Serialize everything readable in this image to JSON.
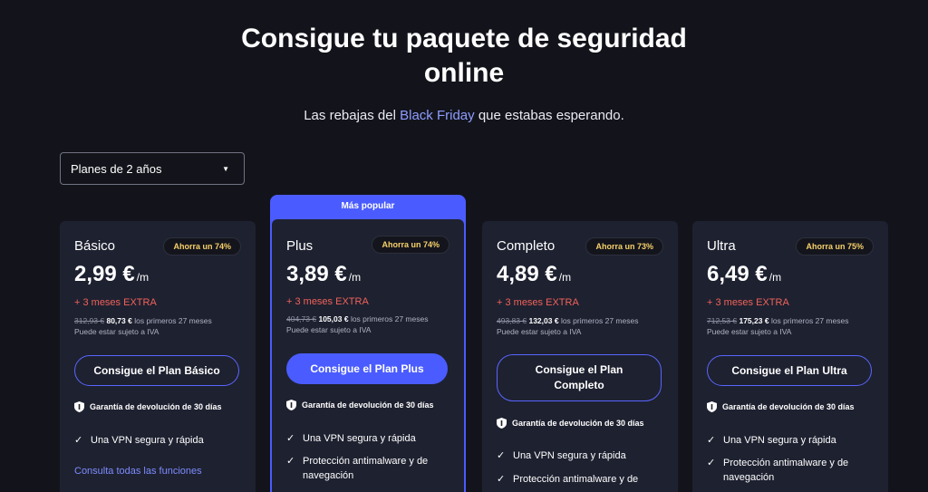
{
  "hero": {
    "title_line1": "Consigue tu paquete de seguridad",
    "title_line2": "online",
    "subtitle_before": "Las rebajas del ",
    "subtitle_highlight": "Black Friday",
    "subtitle_after": " que estabas esperando."
  },
  "term_select": {
    "value": "Planes de 2 años"
  },
  "popular_label": "Más popular",
  "colors": {
    "accent": "#4a5cff",
    "background": "#13141b",
    "card": "#1e2130",
    "extra_red": "#f0625a",
    "badge_yellow": "#f7d16a",
    "link": "#7d8cff"
  },
  "plans": [
    {
      "name": "Básico",
      "badge": "Ahorra un 74%",
      "price": "2,99 €",
      "per": "/m",
      "extra": "+ 3 meses EXTRA",
      "old_total": "312,93 €",
      "new_total": "80,73 €",
      "period_note": "los primeros 27 meses",
      "tax_note": "Puede estar sujeto a IVA",
      "cta": "Consigue el Plan Básico",
      "guarantee": "Garantía de devolución de 30 días",
      "features": [
        "Una VPN segura y rápida"
      ],
      "see_all": "Consulta todas las funciones"
    },
    {
      "name": "Plus",
      "badge": "Ahorra un 74%",
      "price": "3,89 €",
      "per": "/m",
      "extra": "+ 3 meses EXTRA",
      "old_total": "404,73 €",
      "new_total": "105,03 €",
      "period_note": "los primeros 27 meses",
      "tax_note": "Puede estar sujeto a IVA",
      "cta": "Consigue el Plan Plus",
      "guarantee": "Garantía de devolución de 30 días",
      "features": [
        "Una VPN segura y rápida",
        "Protección antimalware y de navegación"
      ]
    },
    {
      "name": "Completo",
      "badge": "Ahorra un 73%",
      "price": "4,89 €",
      "per": "/m",
      "extra": "+ 3 meses EXTRA",
      "old_total": "493,83 €",
      "new_total": "132,03 €",
      "period_note": "los primeros 27 meses",
      "tax_note": "Puede estar sujeto a IVA",
      "cta": "Consigue el Plan Completo",
      "guarantee": "Garantía de devolución de 30 días",
      "features": [
        "Una VPN segura y rápida",
        "Protección antimalware y de"
      ]
    },
    {
      "name": "Ultra",
      "badge": "Ahorra un 75%",
      "price": "6,49 €",
      "per": "/m",
      "extra": "+ 3 meses EXTRA",
      "old_total": "712,53 €",
      "new_total": "175,23 €",
      "period_note": "los primeros 27 meses",
      "tax_note": "Puede estar sujeto a IVA",
      "cta": "Consigue el Plan Ultra",
      "guarantee": "Garantía de devolución de 30 días",
      "features": [
        "Una VPN segura y rápida",
        "Protección antimalware y de navegación"
      ]
    }
  ]
}
